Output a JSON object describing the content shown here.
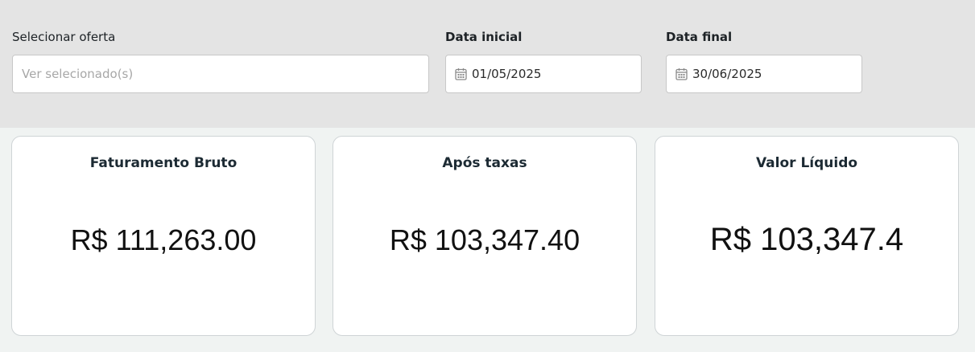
{
  "filters": {
    "offer": {
      "label": "Selecionar oferta",
      "placeholder": "Ver selecionado(s)"
    },
    "start_date": {
      "label": "Data inicial",
      "value": "01/05/2025",
      "icon": "calendar-icon"
    },
    "end_date": {
      "label": "Data final",
      "value": "30/06/2025",
      "icon": "calendar-icon"
    }
  },
  "cards": [
    {
      "title": "Faturamento Bruto",
      "value": "R$ 111,263.00"
    },
    {
      "title": "Após taxas",
      "value": "R$ 103,347.40"
    },
    {
      "title": "Valor Líquido",
      "value": "R$ 103,347.4"
    }
  ],
  "colors": {
    "filter_background": "#e4e4e4",
    "page_background": "#f0f3f2",
    "card_title": "#1c2a33"
  }
}
